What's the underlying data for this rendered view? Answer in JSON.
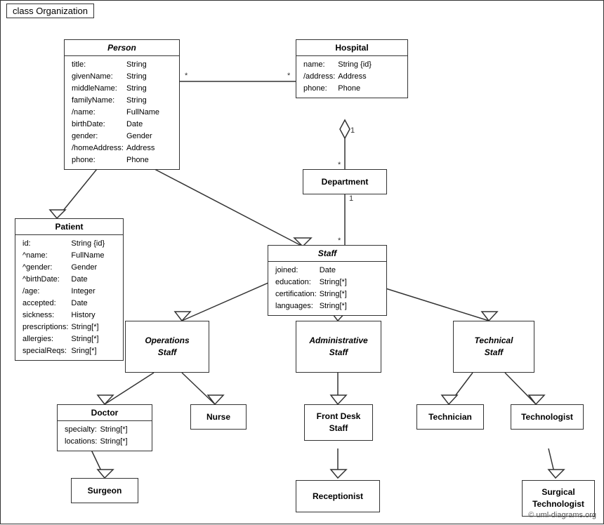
{
  "diagram": {
    "title": "class Organization",
    "classes": {
      "person": {
        "name": "Person",
        "italic": true,
        "attrs": [
          [
            "title:",
            "String"
          ],
          [
            "givenName:",
            "String"
          ],
          [
            "middleName:",
            "String"
          ],
          [
            "familyName:",
            "String"
          ],
          [
            "/name:",
            "FullName"
          ],
          [
            "birthDate:",
            "Date"
          ],
          [
            "gender:",
            "Gender"
          ],
          [
            "/homeAddress:",
            "Address"
          ],
          [
            "phone:",
            "Phone"
          ]
        ]
      },
      "hospital": {
        "name": "Hospital",
        "italic": false,
        "attrs": [
          [
            "name:",
            "String {id}"
          ],
          [
            "/address:",
            "Address"
          ],
          [
            "phone:",
            "Phone"
          ]
        ]
      },
      "patient": {
        "name": "Patient",
        "italic": false,
        "attrs": [
          [
            "id:",
            "String {id}"
          ],
          [
            "^name:",
            "FullName"
          ],
          [
            "^gender:",
            "Gender"
          ],
          [
            "^birthDate:",
            "Date"
          ],
          [
            "/age:",
            "Integer"
          ],
          [
            "accepted:",
            "Date"
          ],
          [
            "sickness:",
            "History"
          ],
          [
            "prescriptions:",
            "String[*]"
          ],
          [
            "allergies:",
            "String[*]"
          ],
          [
            "specialReqs:",
            "Sring[*]"
          ]
        ]
      },
      "department": {
        "name": "Department",
        "italic": false,
        "simple": true
      },
      "staff": {
        "name": "Staff",
        "italic": true,
        "attrs": [
          [
            "joined:",
            "Date"
          ],
          [
            "education:",
            "String[*]"
          ],
          [
            "certification:",
            "String[*]"
          ],
          [
            "languages:",
            "String[*]"
          ]
        ]
      },
      "operations_staff": {
        "name": "Operations\nStaff",
        "italic": true,
        "simple": true
      },
      "administrative_staff": {
        "name": "Administrative\nStaff",
        "italic": true,
        "simple": true
      },
      "technical_staff": {
        "name": "Technical\nStaff",
        "italic": true,
        "simple": true
      },
      "doctor": {
        "name": "Doctor",
        "italic": false,
        "attrs": [
          [
            "specialty:",
            "String[*]"
          ],
          [
            "locations:",
            "String[*]"
          ]
        ]
      },
      "nurse": {
        "name": "Nurse",
        "italic": false,
        "simple": true
      },
      "front_desk_staff": {
        "name": "Front Desk\nStaff",
        "italic": false,
        "simple": true
      },
      "technician": {
        "name": "Technician",
        "italic": false,
        "simple": true
      },
      "technologist": {
        "name": "Technologist",
        "italic": false,
        "simple": true
      },
      "surgeon": {
        "name": "Surgeon",
        "italic": false,
        "simple": true
      },
      "receptionist": {
        "name": "Receptionist",
        "italic": false,
        "simple": true
      },
      "surgical_technologist": {
        "name": "Surgical\nTechnologist",
        "italic": false,
        "simple": true
      }
    },
    "copyright": "© uml-diagrams.org"
  }
}
